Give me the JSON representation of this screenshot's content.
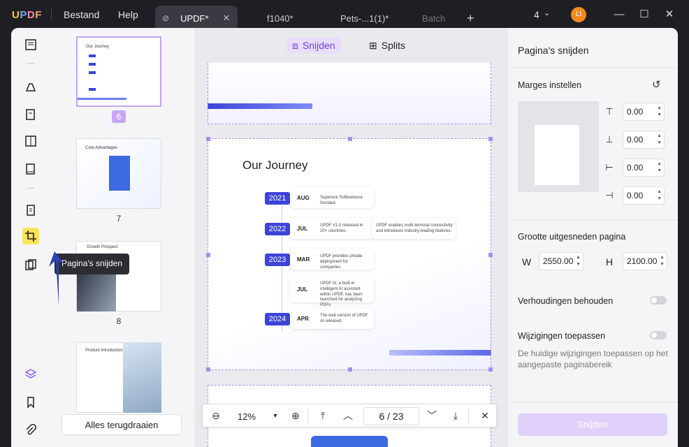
{
  "title_bar": {
    "logo": "UPDF",
    "menu": [
      "Bestand",
      "Help"
    ],
    "tabs": [
      "UPDF*",
      "f1040*",
      "Pets-...1(1)*",
      "Batch"
    ],
    "add_tab": "+",
    "page_count_badge": "4",
    "user_initials": "LI"
  },
  "thumbnails": {
    "items": [
      {
        "title": "Our Journey",
        "page": "6"
      },
      {
        "title": "Core Advantages",
        "page": "7"
      },
      {
        "title": "Growth Prospect",
        "page": "8"
      },
      {
        "title": "Product Introduction",
        "page": ""
      }
    ],
    "revert_button": "Alles terugdraaien"
  },
  "tooltip": "Pagina's snijden",
  "modes": {
    "crop": "Snijden",
    "split": "Splits"
  },
  "page": {
    "title": "Our Journey",
    "timeline": [
      {
        "year": "2021",
        "month": "AUG",
        "text": "Superace Softwareuse founded.",
        "extra": ""
      },
      {
        "year": "2022",
        "month": "JUL",
        "text": "UPDF V1.0 released in 20+ countries.",
        "extra": "UPDF enables multi-terminal connectivity and introduces industry-leading features."
      },
      {
        "year": "2023",
        "month": "MAR",
        "text": "UPDF provides private deployment for companies.",
        "extra": ""
      },
      {
        "year": "",
        "month": "JUL",
        "text": "UPDF AI, a built-in intelligent AI assistant within UPDF, has been launched for analyzing PDFs.",
        "extra": ""
      },
      {
        "year": "2024",
        "month": "APR",
        "text": "The web version of UPDF AI released.",
        "extra": ""
      }
    ]
  },
  "bottom_bar": {
    "zoom": "12%",
    "current_page": "6",
    "page_sep": "/",
    "total_pages": "23"
  },
  "panel": {
    "title": "Pagina's snijden",
    "margins_label": "Marges instellen",
    "margins": [
      "0.00",
      "0.00",
      "0.00",
      "0.00"
    ],
    "size_label": "Grootte uitgesneden pagina",
    "width_label": "W",
    "width": "2550.00",
    "height_label": "H",
    "height": "2100.00",
    "keep_ratio_label": "Verhoudingen behouden",
    "apply_changes_label": "Wijzigingen toepassen",
    "apply_changes_desc": "De huidige wijzigingen toepassen op het aangepaste paginabereik",
    "cut_button": "Snijden"
  },
  "colors": {
    "accent": "#6b3fe0",
    "crop_border": "#a88ce8",
    "year_badge": "#3d44d8",
    "selected_tool": "#fce35c"
  }
}
